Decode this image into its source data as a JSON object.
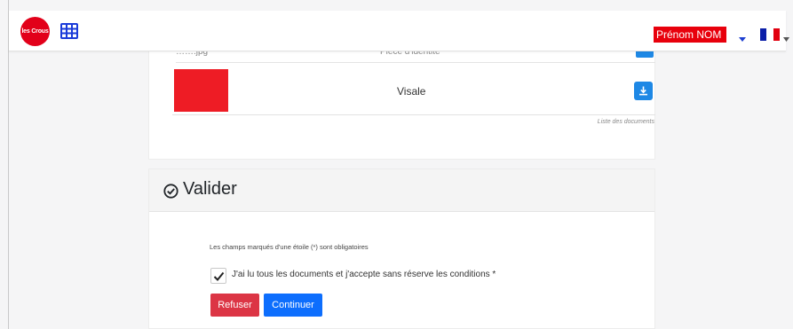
{
  "navbar": {
    "logo_text": "les Crous",
    "user_name": "Prénom NOM",
    "language_flag": "fr-flag-icon",
    "brand_color": "#e2001a"
  },
  "documents": {
    "partial_row": {
      "file_name": "…….jpg",
      "type": "Pièce d'identité"
    },
    "rows": [
      {
        "type": "Visale",
        "thumb_color": "#ee1c25"
      }
    ],
    "caption": "Liste des documents",
    "download_icon": "download-icon",
    "button_color": "#1e88e5"
  },
  "valider": {
    "title": "Valider",
    "icon": "check-circle-icon",
    "mandatory_note": "Les champs marqués d'une étoile (*) sont obligatoires",
    "checkbox": {
      "checked": true,
      "label": "J'ai lu tous les documents et j'accepte sans réserve les conditions *"
    },
    "refuse_label": "Refuser",
    "continue_label": "Continuer",
    "refuse_color": "#dc3545",
    "continue_color": "#0d6efd"
  }
}
